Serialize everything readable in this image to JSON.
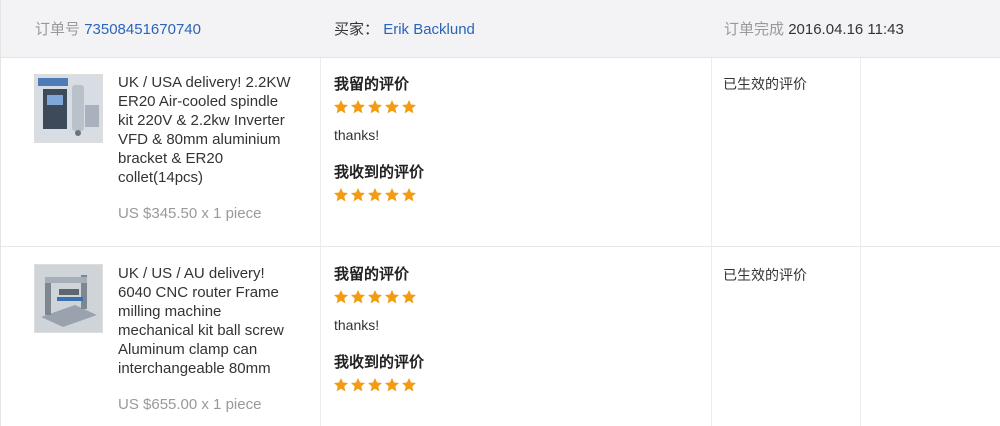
{
  "header": {
    "order_label": "订单号",
    "order_number": "73508451670740",
    "buyer_label": "买家：",
    "buyer_name": "Erik Backlund",
    "complete_label": "订单完成",
    "complete_time": "2016.04.16 11:43"
  },
  "items": [
    {
      "title_lines": [
        "UK / USA delivery! 2.2KW",
        "ER20 Air-cooled spindle",
        "kit 220V & 2.2kw Inverter",
        "VFD & 80mm aluminium",
        "bracket & ER20",
        "collet(14pcs)"
      ],
      "price": "US $345.50 x 1 piece",
      "left_feedback_label": "我留的评价",
      "left_rating": 5,
      "left_comment": "thanks!",
      "received_feedback_label": "我收到的评价",
      "received_rating": 5,
      "status": "已生效的评价"
    },
    {
      "title_lines": [
        "UK / US / AU delivery!",
        "6040 CNC router Frame",
        "milling machine",
        "mechanical kit ball screw",
        "Aluminum clamp can",
        "interchangeable 80mm"
      ],
      "price": "US $655.00 x 1 piece",
      "left_feedback_label": "我留的评价",
      "left_rating": 5,
      "left_comment": "thanks!",
      "received_feedback_label": "我收到的评价",
      "received_rating": 5,
      "status": "已生效的评价"
    }
  ],
  "colors": {
    "star": "#f39c12",
    "link": "#2b64b8",
    "muted": "#999999"
  }
}
